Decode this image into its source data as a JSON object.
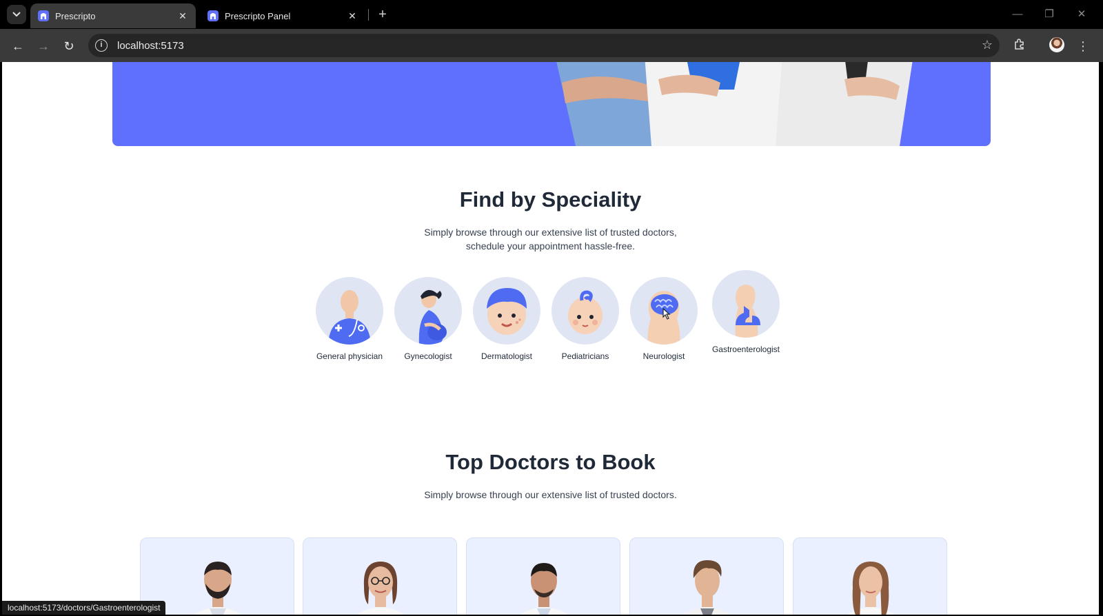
{
  "browser": {
    "tabs": [
      {
        "title": "Prescripto",
        "active": true
      },
      {
        "title": "Prescripto Panel",
        "active": false
      }
    ],
    "url": "localhost:5173",
    "status_url": "localhost:5173/doctors/Gastroenterologist"
  },
  "colors": {
    "brand_primary": "#5f6ffe",
    "card_background": "#eaf0ff",
    "speciality_circle": "#dfe5f3"
  },
  "speciality": {
    "title": "Find by Speciality",
    "subtitle_line1": "Simply browse through our extensive list of trusted doctors,",
    "subtitle_line2": "schedule your appointment hassle-free.",
    "items": [
      {
        "label": "General physician",
        "icon": "general-physician-icon"
      },
      {
        "label": "Gynecologist",
        "icon": "gynecologist-icon"
      },
      {
        "label": "Dermatologist",
        "icon": "dermatologist-icon"
      },
      {
        "label": "Pediatricians",
        "icon": "pediatrician-icon"
      },
      {
        "label": "Neurologist",
        "icon": "neurologist-icon"
      },
      {
        "label": "Gastroenterologist",
        "icon": "gastroenterologist-icon"
      }
    ]
  },
  "top_doctors": {
    "title": "Top Doctors to Book",
    "subtitle": "Simply browse through our extensive list of trusted doctors."
  }
}
